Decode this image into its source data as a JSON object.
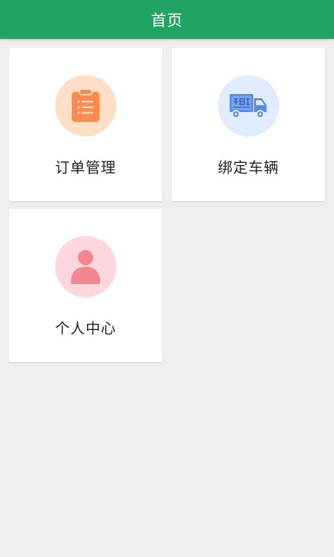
{
  "header": {
    "title": "首页"
  },
  "menu": {
    "items": [
      {
        "label": "订单管理",
        "icon": "clipboard-icon"
      },
      {
        "label": "绑定车辆",
        "icon": "truck-icon"
      },
      {
        "label": "个人中心",
        "icon": "person-icon"
      }
    ]
  },
  "colors": {
    "app_bar": "#1fa463",
    "page_background": "#efefef",
    "orders_circle": "#ffe0c6",
    "orders_icon": "#ff8a50",
    "vehicle_circle": "#e1ecfe",
    "vehicle_icon": "#5b8fe6",
    "profile_circle": "#ffd7dc",
    "profile_icon": "#f3878f"
  }
}
